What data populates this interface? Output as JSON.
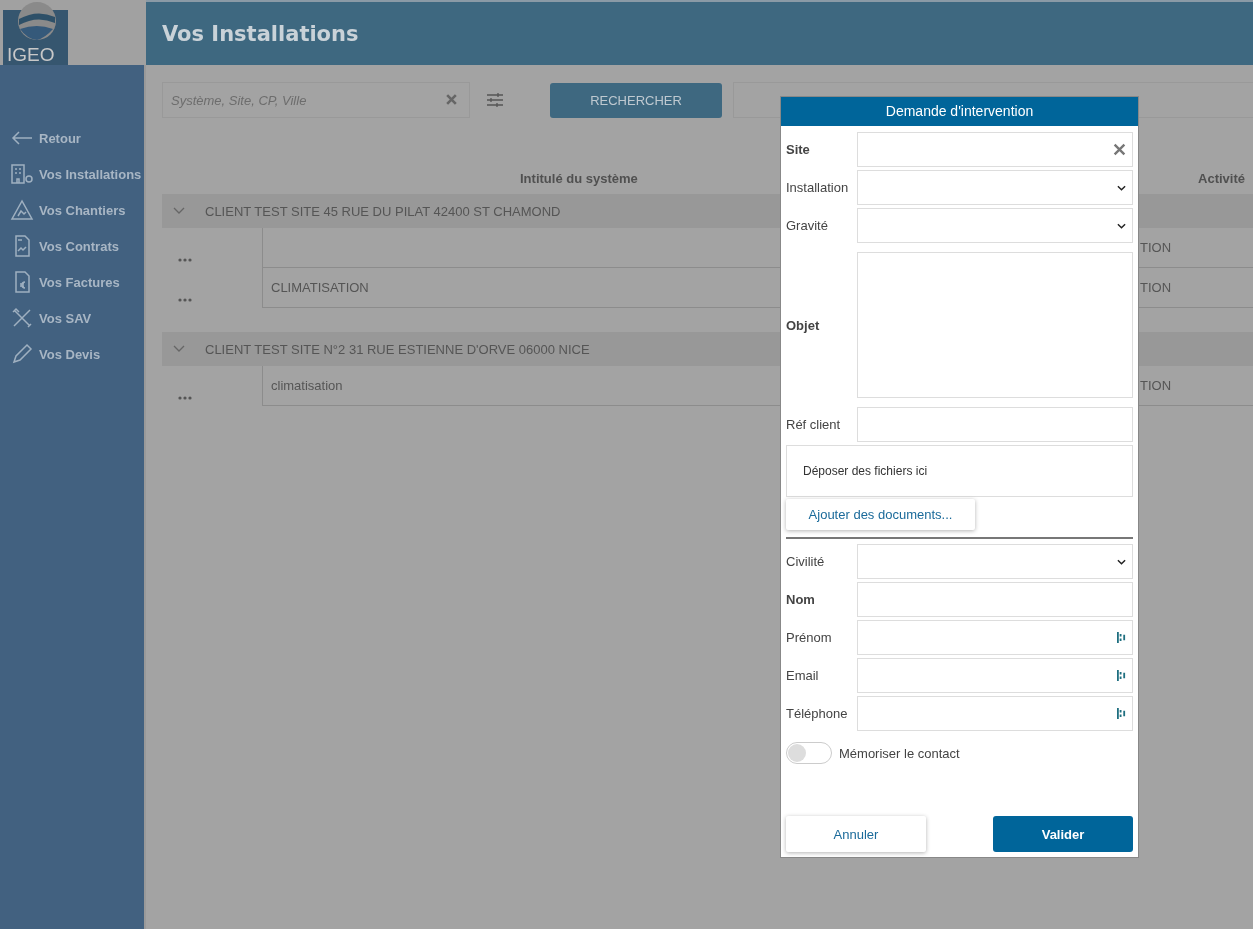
{
  "logo": {
    "text": "IGEO"
  },
  "header": {
    "title": "Vos Installations"
  },
  "sidebar": {
    "items": [
      {
        "label": "Retour",
        "kind": "back"
      },
      {
        "label": "Vos Installations",
        "kind": "building"
      },
      {
        "label": "Vos Chantiers",
        "kind": "site"
      },
      {
        "label": "Vos Contrats",
        "kind": "contract"
      },
      {
        "label": "Vos Factures",
        "kind": "invoice"
      },
      {
        "label": "Vos SAV",
        "kind": "tools"
      },
      {
        "label": "Vos Devis",
        "kind": "pencil"
      }
    ]
  },
  "search": {
    "placeholder": "Système, Site, CP, Ville",
    "button": "RECHERCHER"
  },
  "table": {
    "columns": [
      "Intitulé du système",
      "Activité"
    ],
    "groups": [
      {
        "title": "CLIENT TEST SITE 45 RUE DU PILAT 42400 ST CHAMOND",
        "expanded": true,
        "rows": [
          {
            "activity": "TION"
          },
          {
            "name": "CLIMATISATION",
            "activity": "TION"
          }
        ]
      },
      {
        "title": "CLIENT TEST SITE N°2 31 RUE ESTIENNE D'ORVE 06000 NICE",
        "expanded": true,
        "rows": [
          {
            "name": "climatisation",
            "activity": "TION"
          }
        ]
      }
    ]
  },
  "dialog": {
    "title": "Demande d'intervention",
    "fields": [
      {
        "label": "Site",
        "kind": "clearable",
        "required": true
      },
      {
        "label": "Installation",
        "kind": "select",
        "required": false
      },
      {
        "label": "Gravité",
        "kind": "select",
        "required": false
      },
      {
        "label": "Objet",
        "kind": "textarea",
        "required": true
      },
      {
        "label": "Réf client",
        "kind": "text",
        "required": false
      }
    ],
    "dropzone": "Déposer des fichiers ici",
    "add_button": "Ajouter des documents...",
    "contact_fields": [
      {
        "label": "Civilité",
        "kind": "select",
        "required": false
      },
      {
        "label": "Nom",
        "kind": "text",
        "required": true
      },
      {
        "label": "Prénom",
        "kind": "autofill",
        "required": false
      },
      {
        "label": "Email",
        "kind": "autofill",
        "required": false
      },
      {
        "label": "Téléphone",
        "kind": "autofill",
        "required": false
      }
    ],
    "remember": {
      "label": "Mémoriser le contact",
      "on": false
    },
    "cancel": "Annuler",
    "submit": "Valider"
  }
}
